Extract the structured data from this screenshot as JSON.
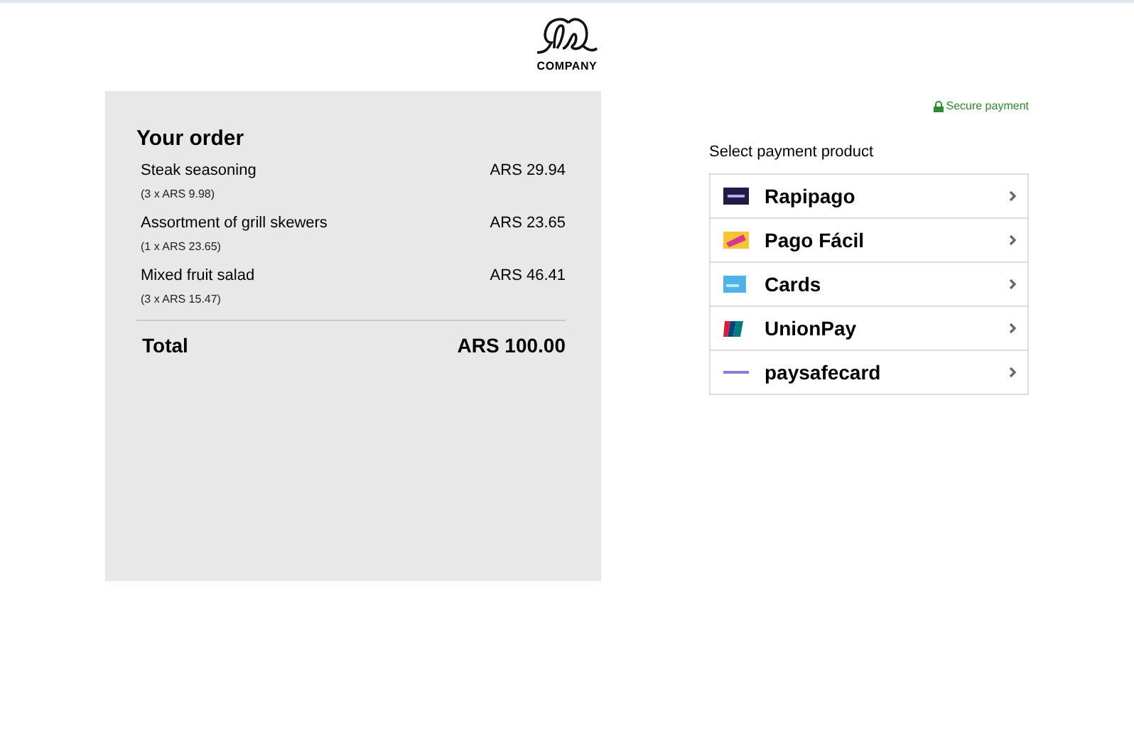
{
  "logo": {
    "text": "COMPANY"
  },
  "order": {
    "title": "Your order",
    "items": [
      {
        "name": "Steak seasoning",
        "detail": "(3 x ARS 9.98)",
        "price": "ARS 29.94"
      },
      {
        "name": "Assortment of grill skewers",
        "detail": "(1 x ARS 23.65)",
        "price": "ARS 23.65"
      },
      {
        "name": "Mixed fruit salad",
        "detail": "(3 x ARS 15.47)",
        "price": "ARS 46.41"
      }
    ],
    "total_label": "Total",
    "total": "ARS 100.00"
  },
  "secure": "Secure payment",
  "payment": {
    "heading": "Select payment product",
    "methods": [
      {
        "kind": "rapipago",
        "label": "Rapipago"
      },
      {
        "kind": "pagofacil",
        "label": "Pago Fácil"
      },
      {
        "kind": "card",
        "label": "Cards"
      },
      {
        "kind": "unionpay",
        "label": "UnionPay"
      },
      {
        "kind": "paysafecard",
        "label": "paysafecard"
      }
    ]
  }
}
